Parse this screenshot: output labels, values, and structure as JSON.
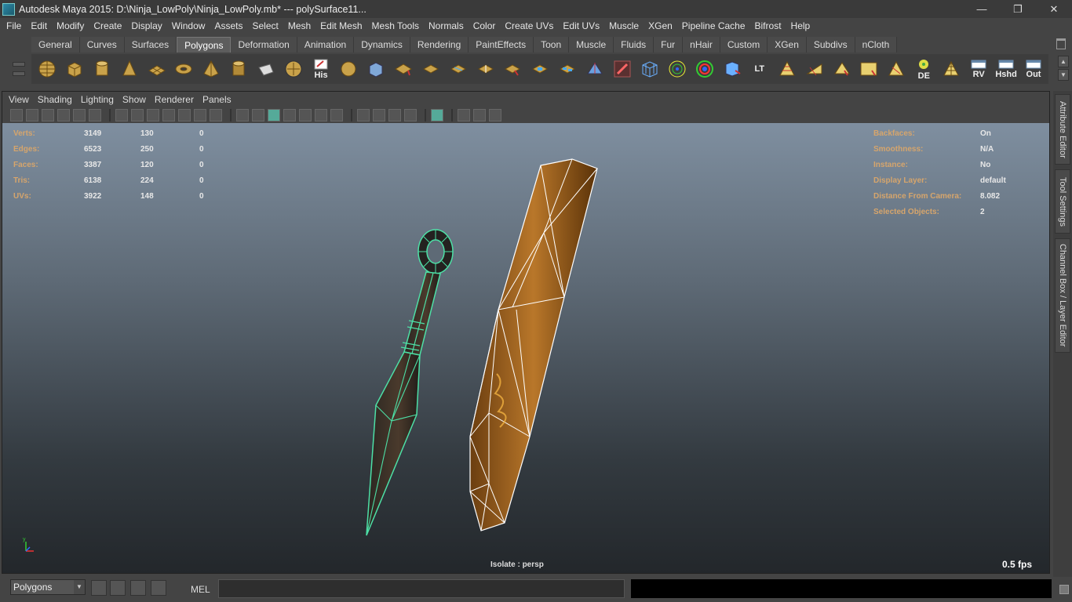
{
  "window": {
    "title": "Autodesk Maya 2015: D:\\Ninja_LowPoly\\Ninja_LowPoly.mb*   ---   polySurface11...",
    "minimize": "—",
    "restore": "❐",
    "close": "✕"
  },
  "menubar": {
    "items": [
      "File",
      "Edit",
      "Modify",
      "Create",
      "Display",
      "Window",
      "Assets",
      "Select",
      "Mesh",
      "Edit Mesh",
      "Mesh Tools",
      "Normals",
      "Color",
      "Create UVs",
      "Edit UVs",
      "Muscle",
      "XGen",
      "Pipeline Cache",
      "Bifrost",
      "Help"
    ]
  },
  "shelf": {
    "tabs": [
      "General",
      "Curves",
      "Surfaces",
      "Polygons",
      "Deformation",
      "Animation",
      "Dynamics",
      "Rendering",
      "PaintEffects",
      "Toon",
      "Muscle",
      "Fluids",
      "Fur",
      "nHair",
      "Custom",
      "XGen",
      "Subdivs",
      "nCloth"
    ],
    "active_tab": "Polygons",
    "text_icons": {
      "his": "His",
      "lt": "LT",
      "de": "DE",
      "rv": "RV",
      "hshd": "Hshd",
      "out": "Out"
    }
  },
  "panel": {
    "menu": [
      "View",
      "Shading",
      "Lighting",
      "Show",
      "Renderer",
      "Panels"
    ]
  },
  "hud_left": {
    "rows": [
      {
        "label": "Verts:",
        "v1": "3149",
        "v2": "130",
        "v3": "0"
      },
      {
        "label": "Edges:",
        "v1": "6523",
        "v2": "250",
        "v3": "0"
      },
      {
        "label": "Faces:",
        "v1": "3387",
        "v2": "120",
        "v3": "0"
      },
      {
        "label": "Tris:",
        "v1": "6138",
        "v2": "224",
        "v3": "0"
      },
      {
        "label": "UVs:",
        "v1": "3922",
        "v2": "148",
        "v3": "0"
      }
    ]
  },
  "hud_right": {
    "rows": [
      {
        "label": "Backfaces:",
        "value": "On"
      },
      {
        "label": "Smoothness:",
        "value": "N/A"
      },
      {
        "label": "Instance:",
        "value": "No"
      },
      {
        "label": "Display Layer:",
        "value": "default"
      },
      {
        "label": "Distance From Camera:",
        "value": "8.082"
      },
      {
        "label": "Selected Objects:",
        "value": "2"
      }
    ]
  },
  "viewport": {
    "isolate": "Isolate : persp",
    "fps": "0.5 fps",
    "axis_y": "y"
  },
  "side_tabs": [
    "Attribute Editor",
    "Tool Settings",
    "Channel Box / Layer Editor"
  ],
  "command_line": {
    "mode": "Polygons",
    "lang": "MEL"
  },
  "colors": {
    "hud_label": "#d6a56c",
    "selection_wire": "#4de0a6",
    "wood": "#8a5418"
  }
}
